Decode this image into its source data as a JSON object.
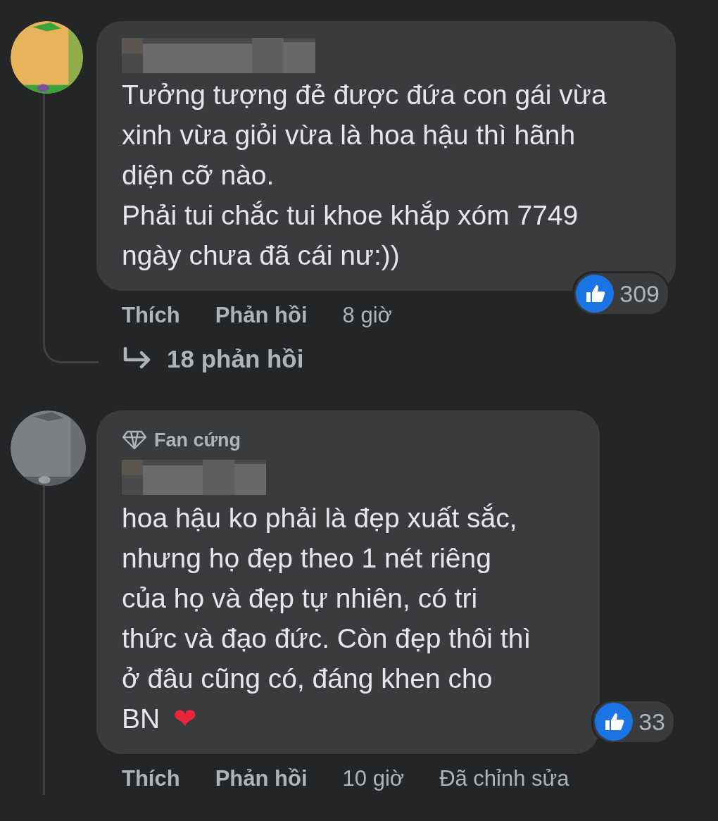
{
  "comments": [
    {
      "avatar": {
        "kind": "picture"
      },
      "name_redacted": true,
      "paragraphs": [
        "Tưởng tượng đẻ được đứa con gái vừa xinh vừa giỏi vừa là hoa hậu thì hãnh diện cỡ nào.",
        "Phải tui chắc tui khoe khắp xóm 7749 ngày chưa đã cái nư:))"
      ],
      "reaction_count": "309",
      "actions": [
        "Thích",
        "Phản hồi"
      ],
      "time": "8 giờ",
      "replies_link": "18 phản hồi"
    },
    {
      "avatar": {
        "kind": "picture"
      },
      "badge": "Fan cứng",
      "name_redacted": true,
      "paragraphs": [
        "hoa hậu ko phải là đẹp xuất sắc, nhưng họ đẹp theo 1 nét riêng của họ và đẹp tự nhiên, có tri thức và đạo đức. Còn đẹp thôi thì ở đâu cũng có, đáng khen cho BN"
      ],
      "end_emoji": "❤",
      "reaction_count": "33",
      "actions": [
        "Thích",
        "Phản hồi"
      ],
      "time": "10 giờ",
      "edited": "Đã chỉnh sửa"
    }
  ]
}
